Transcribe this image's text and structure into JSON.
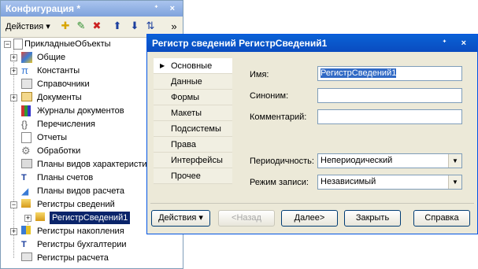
{
  "config_panel": {
    "title": "Конфигурация *",
    "title_buttons": "ᐩ ×",
    "toolbar": {
      "actions_label": "Действия ▾",
      "more": "»"
    },
    "tree": [
      {
        "label": "ПрикладныеОбъекты",
        "icon": "folder-icon"
      },
      {
        "label": "Общие",
        "icon": "common-icon"
      },
      {
        "label": "Константы",
        "icon": "constants-icon"
      },
      {
        "label": "Справочники",
        "icon": "catalogs-icon"
      },
      {
        "label": "Документы",
        "icon": "documents-icon"
      },
      {
        "label": "Журналы документов",
        "icon": "journals-icon"
      },
      {
        "label": "Перечисления",
        "icon": "enums-icon"
      },
      {
        "label": "Отчеты",
        "icon": "reports-icon"
      },
      {
        "label": "Обработки",
        "icon": "dataprocessors-icon"
      },
      {
        "label": "Планы видов характеристи",
        "icon": "char-plans-icon"
      },
      {
        "label": "Планы счетов",
        "icon": "accounts-icon"
      },
      {
        "label": "Планы видов расчета",
        "icon": "calc-plans-icon"
      },
      {
        "label": "Регистры сведений",
        "icon": "info-registers-icon"
      },
      {
        "label": "РегистрСведений1",
        "icon": "register-icon",
        "selected": true
      },
      {
        "label": "Регистры накопления",
        "icon": "accum-registers-icon"
      },
      {
        "label": "Регистры бухгалтерии",
        "icon": "acc-registers-icon"
      },
      {
        "label": "Регистры расчета",
        "icon": "calc-registers-icon"
      }
    ]
  },
  "dialog": {
    "title": "Регистр сведений РегистрСведений1",
    "title_buttons": "ᐩ ×",
    "tabs": [
      "Основные",
      "Данные",
      "Формы",
      "Макеты",
      "Подсистемы",
      "Права",
      "Интерфейсы",
      "Прочее"
    ],
    "fields": {
      "name_label": "Имя:",
      "name_value": "РегистрСведений1",
      "synonym_label": "Синоним:",
      "synonym_value": "",
      "comment_label": "Комментарий:",
      "comment_value": "",
      "periodicity_label": "Периодичность:",
      "periodicity_value": "Непериодический",
      "mode_label": "Режим записи:",
      "mode_value": "Независимый"
    },
    "buttons": {
      "actions": "Действия ▾",
      "back": "<Назад",
      "next": "Далее>",
      "close": "Закрыть",
      "help": "Справка"
    }
  }
}
